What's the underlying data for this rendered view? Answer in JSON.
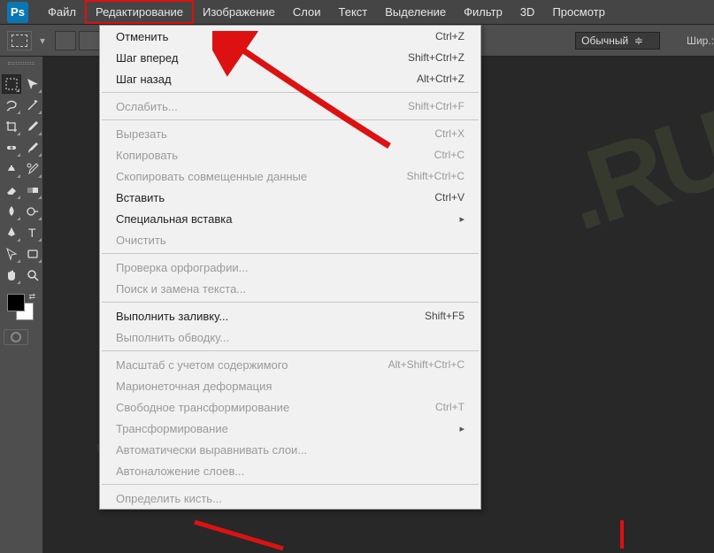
{
  "logo": "Ps",
  "menu": {
    "file": "Файл",
    "edit": "Редактирование",
    "image": "Изображение",
    "layers": "Слои",
    "text": "Текст",
    "select": "Выделение",
    "filter": "Фильтр",
    "threeD": "3D",
    "view": "Просмотр"
  },
  "options": {
    "mode_label": "Обычный",
    "width_label": "Шир.:"
  },
  "dropdown": [
    {
      "type": "item",
      "label": "Отменить",
      "shortcut": "Ctrl+Z"
    },
    {
      "type": "item",
      "label": "Шаг вперед",
      "shortcut": "Shift+Ctrl+Z"
    },
    {
      "type": "item",
      "label": "Шаг назад",
      "shortcut": "Alt+Ctrl+Z"
    },
    {
      "type": "sep"
    },
    {
      "type": "item",
      "label": "Ослабить...",
      "shortcut": "Shift+Ctrl+F",
      "disabled": true
    },
    {
      "type": "sep"
    },
    {
      "type": "item",
      "label": "Вырезать",
      "shortcut": "Ctrl+X",
      "disabled": true
    },
    {
      "type": "item",
      "label": "Копировать",
      "shortcut": "Ctrl+C",
      "disabled": true
    },
    {
      "type": "item",
      "label": "Скопировать совмещенные данные",
      "shortcut": "Shift+Ctrl+C",
      "disabled": true
    },
    {
      "type": "item",
      "label": "Вставить",
      "shortcut": "Ctrl+V"
    },
    {
      "type": "item",
      "label": "Специальная вставка",
      "sub": true
    },
    {
      "type": "item",
      "label": "Очистить",
      "disabled": true
    },
    {
      "type": "sep"
    },
    {
      "type": "item",
      "label": "Проверка орфографии...",
      "disabled": true
    },
    {
      "type": "item",
      "label": "Поиск и замена текста...",
      "disabled": true
    },
    {
      "type": "sep"
    },
    {
      "type": "item",
      "label": "Выполнить заливку...",
      "shortcut": "Shift+F5"
    },
    {
      "type": "item",
      "label": "Выполнить обводку...",
      "disabled": true
    },
    {
      "type": "sep"
    },
    {
      "type": "item",
      "label": "Масштаб с учетом содержимого",
      "shortcut": "Alt+Shift+Ctrl+C",
      "disabled": true
    },
    {
      "type": "item",
      "label": "Марионеточная деформация",
      "disabled": true
    },
    {
      "type": "item",
      "label": "Свободное трансформирование",
      "shortcut": "Ctrl+T",
      "disabled": true
    },
    {
      "type": "item",
      "label": "Трансформирование",
      "disabled": true,
      "sub": true
    },
    {
      "type": "item",
      "label": "Автоматически выравнивать слои...",
      "disabled": true
    },
    {
      "type": "item",
      "label": "Автоналожение слоев...",
      "disabled": true
    },
    {
      "type": "sep"
    },
    {
      "type": "item",
      "label": "Определить кисть...",
      "disabled": true
    }
  ],
  "watermark": ".RU",
  "watermark2": "LOG"
}
